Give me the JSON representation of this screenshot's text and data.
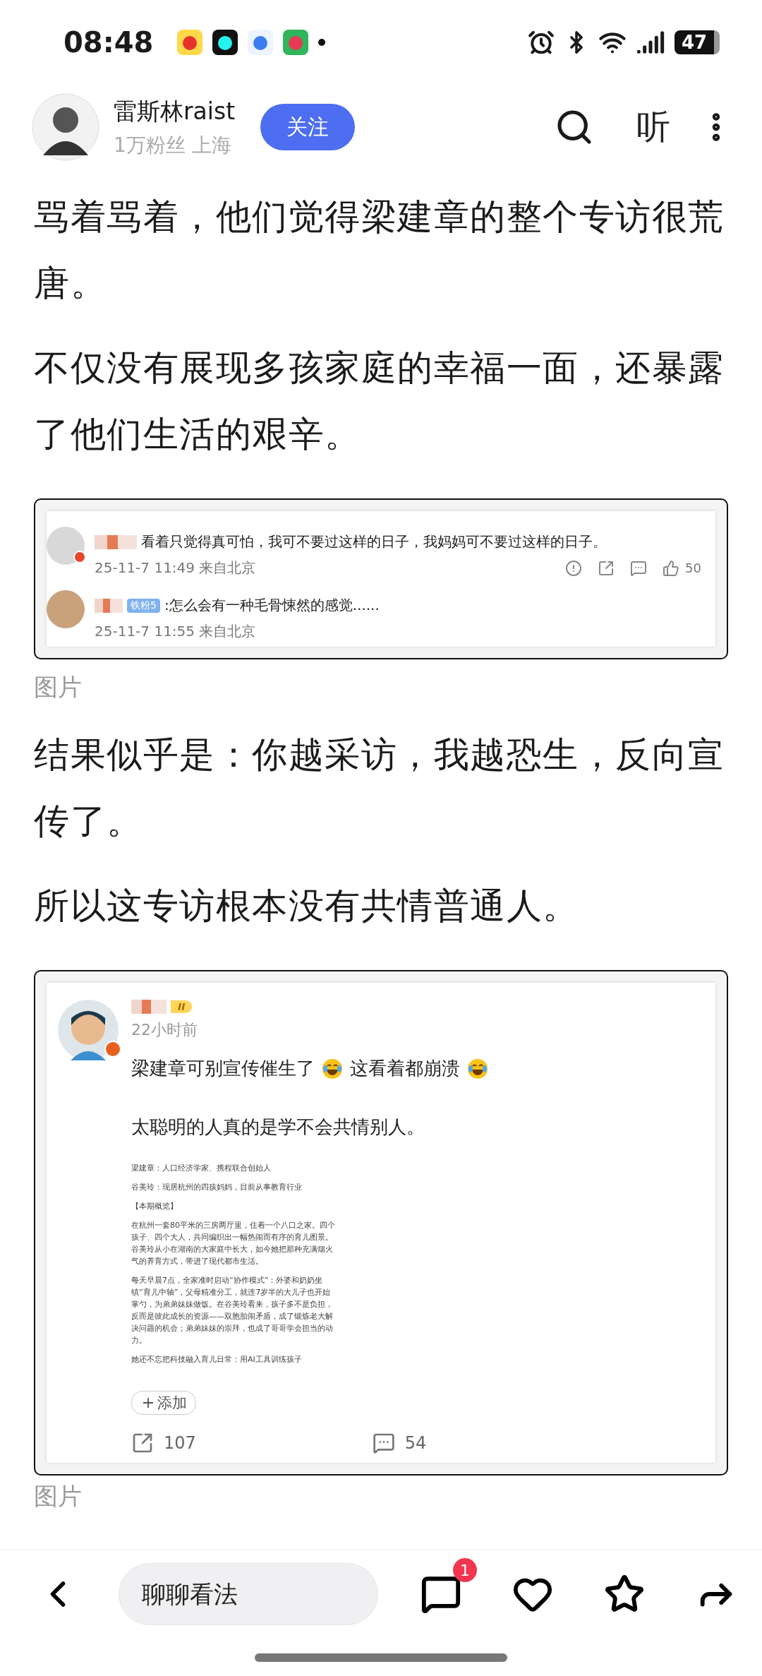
{
  "status_bar": {
    "time": "08:48",
    "battery": "47"
  },
  "header": {
    "author_name": "雷斯林raist",
    "author_meta": "1万粉丝 上海",
    "follow_button": "关注",
    "listen_button": "听"
  },
  "article": [
    {
      "kind": "paragraph",
      "text": "骂着骂着，他们觉得梁建章的整个专访很荒唐。"
    },
    {
      "kind": "paragraph",
      "text": "不仅没有展现多孩家庭的幸福一面，还暴露了他们生活的艰辛。"
    },
    {
      "kind": "comment_screenshot",
      "comments": [
        {
          "verified": true,
          "text": "看着只觉得真可怕，我可不要过这样的日子，我妈妈可不要过这样的日子。",
          "meta": "25-11-7 11:49 来自北京",
          "likes": "50"
        },
        {
          "verified": false,
          "fan_badge": "铁粉5",
          "text": ":怎么会有一种毛骨悚然的感觉......",
          "meta": "25-11-7 11:55 来自北京"
        }
      ]
    },
    {
      "kind": "caption",
      "text": "图片"
    },
    {
      "kind": "paragraph",
      "text": "结果似乎是：你越采访，我越恐生，反向宣传了。"
    },
    {
      "kind": "paragraph",
      "text": "所以这专访根本没有共情普通人。"
    },
    {
      "kind": "post_screenshot",
      "level_badge": "II",
      "time": "22小时前",
      "content": [
        {
          "kind": "text",
          "text": "梁建章可别宣传催生了"
        },
        {
          "kind": "emoji"
        },
        {
          "kind": "text",
          "text": "这看着都崩溃"
        },
        {
          "kind": "emoji"
        }
      ],
      "second_line": "太聪明的人真的是学不会共情别人。",
      "document": [
        "梁建章：人口经济学家、携程联合创始人",
        "谷美玲：现居杭州的四孩妈妈，目前从事教育行业",
        "【本期概览】",
        "在杭州一套80平米的三房两厅里，住着一个八口之家。四个孩子、四个大人，共同编织出一幅热闹而有序的育儿图景。谷美玲从小在湖南的大家庭中长大，如今她把那种充满烟火气的养育方式，带进了现代都市生活。",
        "每天早晨7点，全家准时启动“协作模式”：外婆和奶奶坐镇“育儿中轴”，父母精准分工，就连7岁半的大儿子也开始掌勺，为弟弟妹妹做饭。在谷美玲看来，孩子多不是负担，反而是彼此成长的资源——双胞胎闹矛盾，成了锻炼老大解决问题的机会；弟弟妹妹的崇拜，也成了哥哥学会担当的动力。",
        "她还不忘把科技融入育儿日常：用AI工具训练孩子"
      ],
      "add_chip": "添加",
      "stats": [
        {
          "kind": "share",
          "count": "107"
        },
        {
          "kind": "comment",
          "count": "54"
        }
      ]
    },
    {
      "kind": "caption",
      "text": "图片"
    }
  ],
  "bottom_bar": {
    "comment_input": {
      "placeholder": "聊聊看法"
    },
    "comment_badge": "1"
  }
}
